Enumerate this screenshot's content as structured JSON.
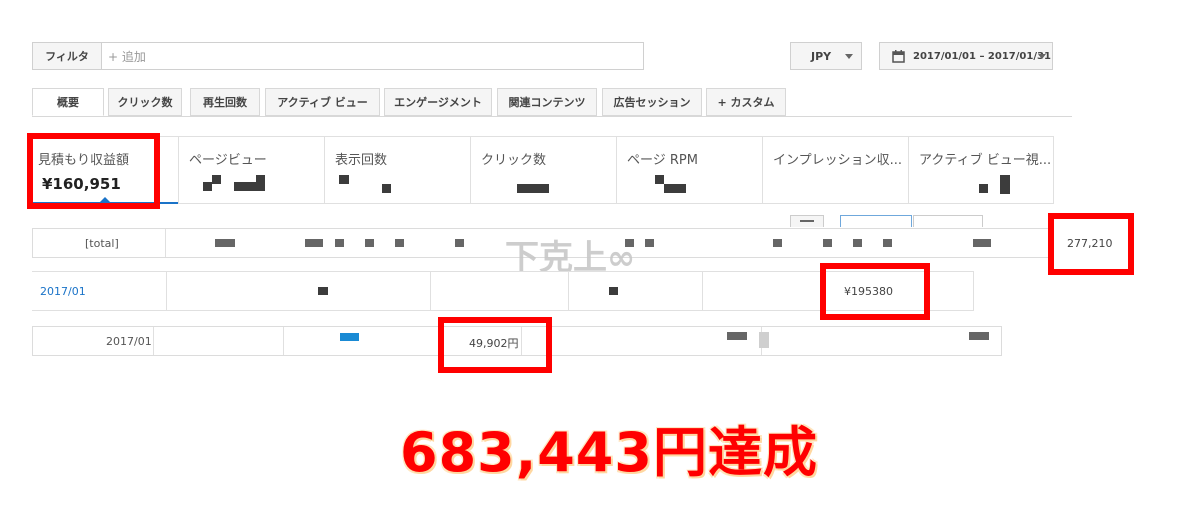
{
  "toolbar": {
    "filter_label": "フィルタ",
    "add_placeholder": "+ 追加",
    "currency": "JPY",
    "date_range": "2017/01/01 – 2017/01/31"
  },
  "tabs": [
    {
      "label": "概要"
    },
    {
      "label": "クリック数"
    },
    {
      "label": "再生回数"
    },
    {
      "label": "アクティブ ビュー"
    },
    {
      "label": "エンゲージメント"
    },
    {
      "label": "関連コンテンツ"
    },
    {
      "label": "広告セッション"
    },
    {
      "label": "+ カスタム"
    }
  ],
  "metrics": [
    {
      "label": "見積もり収益額",
      "value": "¥160,951"
    },
    {
      "label": "ページビュー"
    },
    {
      "label": "表示回数"
    },
    {
      "label": "クリック数"
    },
    {
      "label": "ページ RPM"
    },
    {
      "label": "インプレッション収..."
    },
    {
      "label": "アクティブ ビュー視..."
    }
  ],
  "table": {
    "total_label": "[total]",
    "total_value": "277,210",
    "row1_date": "2017/01",
    "row1_value": "¥195380",
    "row2_date": "2017/01",
    "row2_value": "49,902円"
  },
  "watermark": "下克上∞",
  "headline": "683,443円達成",
  "colors": {
    "highlight": "#ff0000",
    "link": "#1a73c8",
    "headline": "#ff0000",
    "accent_bar": "#1a8ad4"
  }
}
